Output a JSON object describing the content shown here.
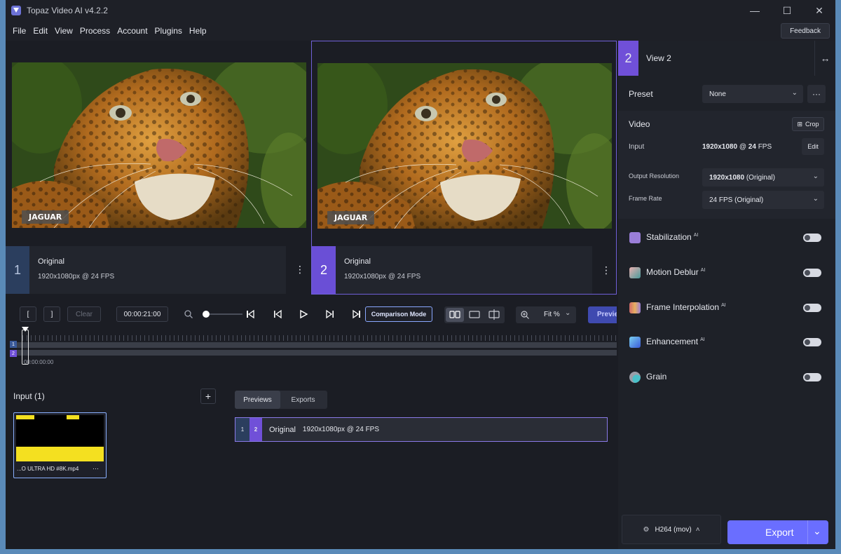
{
  "window": {
    "title": "Topaz Video AI  v4.2.2"
  },
  "menu": [
    "File",
    "Edit",
    "View",
    "Process",
    "Account",
    "Plugins",
    "Help"
  ],
  "feedback_label": "Feedback",
  "panes": [
    {
      "num": "1",
      "title": "Original",
      "info": "1920x1080px @ 24 FPS",
      "badge": "JAGUAR"
    },
    {
      "num": "2",
      "title": "Original",
      "info": "1920x1080px @ 24 FPS",
      "badge": "JAGUAR"
    }
  ],
  "controls": {
    "in_mark": "[",
    "out_mark": "]",
    "clear": "Clear",
    "timecode": "00:00:21:00",
    "comparison_mode": "Comparison Mode",
    "zoom": "Fit %",
    "preview": "Previe"
  },
  "timeline": {
    "track1": "1",
    "track2": "2",
    "start_time": "00:00:00:00"
  },
  "input": {
    "title": "Input (1)",
    "file_name": "...O ULTRA HD #8K.mp4",
    "more": "···"
  },
  "preview_tabs": [
    "Previews",
    "Exports"
  ],
  "preview_item": {
    "n1": "1",
    "n2": "2",
    "label": "Original",
    "info": "1920x1080px @ 24 FPS"
  },
  "sidebar": {
    "view_num": "2",
    "view_title": "View 2",
    "preset_label": "Preset",
    "preset_value": "None",
    "video_title": "Video",
    "crop_label": "Crop",
    "input_label": "Input",
    "input_res": "1920x1080",
    "input_at": "@",
    "input_fps": "24",
    "input_fps_unit": "FPS",
    "edit_label": "Edit",
    "output_res_label": "Output Resolution",
    "output_res_value_b": "1920x1080",
    "output_res_value": "(Original)",
    "frame_rate_label": "Frame Rate",
    "frame_rate_value": "24 FPS (Original)",
    "features": [
      {
        "name": "Stabilization",
        "ai": "AI",
        "color": "#9a7ed8"
      },
      {
        "name": "Motion Deblur",
        "ai": "AI",
        "color": "#5aa0a0"
      },
      {
        "name": "Frame Interpolation",
        "ai": "AI",
        "color": "#d06a6a"
      },
      {
        "name": "Enhancement",
        "ai": "AI",
        "color": "#4a8ad8"
      },
      {
        "name": "Grain",
        "ai": "",
        "color": "#4ac0c8"
      }
    ],
    "codec": "H264 (mov)",
    "export_label": "Export"
  }
}
